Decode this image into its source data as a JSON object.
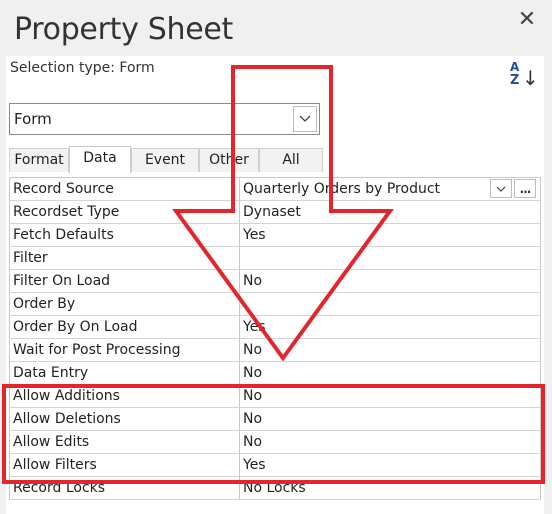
{
  "window": {
    "title": "Property Sheet",
    "close_icon": "close-icon"
  },
  "selection": {
    "label": "Selection type:",
    "value": "Form"
  },
  "sort_icon": "sort-az-icon",
  "object_combo": {
    "value": "Form",
    "dropdown_icon": "chevron-down-icon"
  },
  "tabs": [
    {
      "label": "Format",
      "active": false
    },
    {
      "label": "Data",
      "active": true
    },
    {
      "label": "Event",
      "active": false
    },
    {
      "label": "Other",
      "active": false
    },
    {
      "label": "All",
      "active": false
    }
  ],
  "properties": [
    {
      "name": "Record Source",
      "value": "Quarterly Orders by Product",
      "has_builder": true
    },
    {
      "name": "Recordset Type",
      "value": "Dynaset"
    },
    {
      "name": "Fetch Defaults",
      "value": "Yes"
    },
    {
      "name": "Filter",
      "value": ""
    },
    {
      "name": "Filter On Load",
      "value": "No"
    },
    {
      "name": "Order By",
      "value": ""
    },
    {
      "name": "Order By On Load",
      "value": "Yes"
    },
    {
      "name": "Wait for Post Processing",
      "value": "No"
    },
    {
      "name": "Data Entry",
      "value": "No"
    },
    {
      "name": "Allow Additions",
      "value": "No"
    },
    {
      "name": "Allow Deletions",
      "value": "No"
    },
    {
      "name": "Allow Edits",
      "value": "No"
    },
    {
      "name": "Allow Filters",
      "value": "Yes"
    },
    {
      "name": "Record Locks",
      "value": "No Locks"
    }
  ],
  "annotation": {
    "color": "#e3262b",
    "highlighted_properties": [
      "Allow Additions",
      "Allow Deletions",
      "Allow Edits",
      "Allow Filters"
    ]
  },
  "builder_button_label": "..."
}
